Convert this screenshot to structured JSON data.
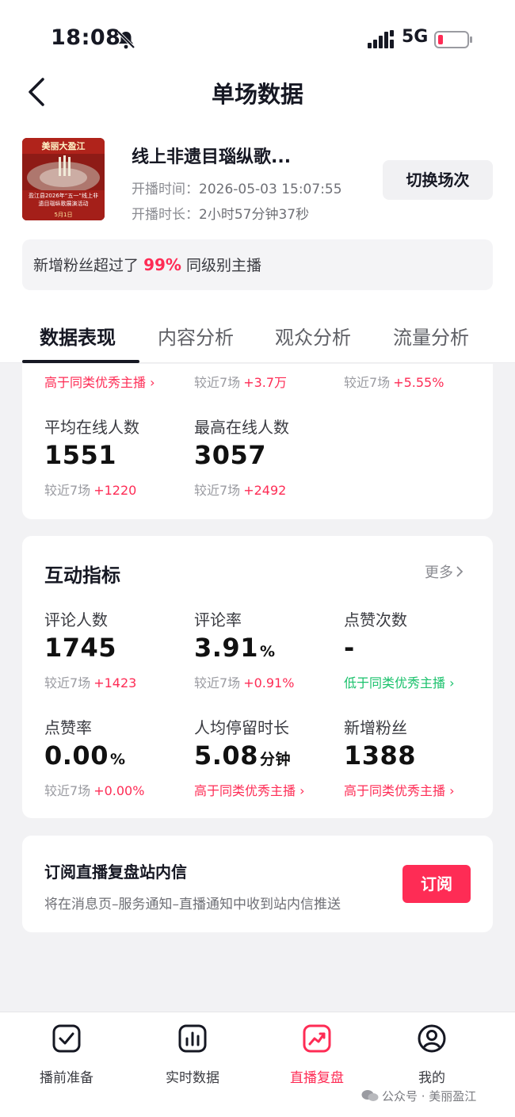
{
  "status_bar": {
    "time": "18:08",
    "network": "5G"
  },
  "nav": {
    "title": "单场数据"
  },
  "session": {
    "thumbnail": {
      "banner": "美丽大盈江",
      "caption": "盈江县2026年“五一”线上非遗目瑙纵歌展演活动",
      "date": "5月1日"
    },
    "title": "线上非遗目瑙纵歌...",
    "start_label": "开播时间：",
    "start_value": "2026-05-03 15:07:55",
    "duration_label": "开播时长：",
    "duration_value": "2小时57分钟37秒",
    "switch_button": "切换场次"
  },
  "fans_banner": {
    "prefix": "新增粉丝超过了",
    "percent": "99%",
    "suffix": "同级别主播"
  },
  "tabs": [
    {
      "label": "数据表现",
      "active": true
    },
    {
      "label": "内容分析",
      "active": false
    },
    {
      "label": "观众分析",
      "active": false
    },
    {
      "label": "流量分析",
      "active": false
    }
  ],
  "top_card": {
    "row0": {
      "tag": "高于同类优秀主播 ›",
      "cmp1_label": "较近7场",
      "cmp1_delta": "+3.7万",
      "cmp2_label": "较近7场",
      "cmp2_delta": "+5.55%"
    },
    "metrics": [
      {
        "label": "平均在线人数",
        "value": "1551",
        "cmp_label": "较近7场",
        "cmp_delta": "+1220"
      },
      {
        "label": "最高在线人数",
        "value": "3057",
        "cmp_label": "较近7场",
        "cmp_delta": "+2492"
      }
    ]
  },
  "interaction": {
    "title": "互动指标",
    "more": "更多",
    "metrics": [
      {
        "label": "评论人数",
        "value": "1745",
        "unit": "",
        "cmp_label": "较近7场",
        "cmp_delta": "+1423"
      },
      {
        "label": "评论率",
        "value": "3.91",
        "unit": "%",
        "cmp_label": "较近7场",
        "cmp_delta": "+0.91%"
      },
      {
        "label": "点赞次数",
        "value": "-",
        "unit": "",
        "tag": "低于同类优秀主播 ›"
      },
      {
        "label": "点赞率",
        "value": "0.00",
        "unit": "%",
        "cmp_label": "较近7场",
        "cmp_delta": "+0.00%"
      },
      {
        "label": "人均停留时长",
        "value": "5.08",
        "unit": "分钟",
        "tag": "高于同类优秀主播 ›"
      },
      {
        "label": "新增粉丝",
        "value": "1388",
        "unit": "",
        "tag": "高于同类优秀主播 ›"
      }
    ]
  },
  "subscribe": {
    "title": "订阅直播复盘站内信",
    "desc": "将在消息页–服务通知–直播通知中收到站内信推送",
    "button": "订阅"
  },
  "bottom_nav": [
    {
      "label": "播前准备",
      "icon": "checkbox-icon",
      "active": false
    },
    {
      "label": "实时数据",
      "icon": "bar-chart-icon",
      "active": false
    },
    {
      "label": "直播复盘",
      "icon": "trend-chart-icon",
      "active": true
    },
    {
      "label": "我的",
      "icon": "user-icon",
      "active": false
    }
  ],
  "watermark": "公众号 · 美丽盈江",
  "colors": {
    "accent": "#fe2c55",
    "positive_tag": "#19c16b",
    "text": "#161823",
    "muted": "#9a9ba1"
  }
}
